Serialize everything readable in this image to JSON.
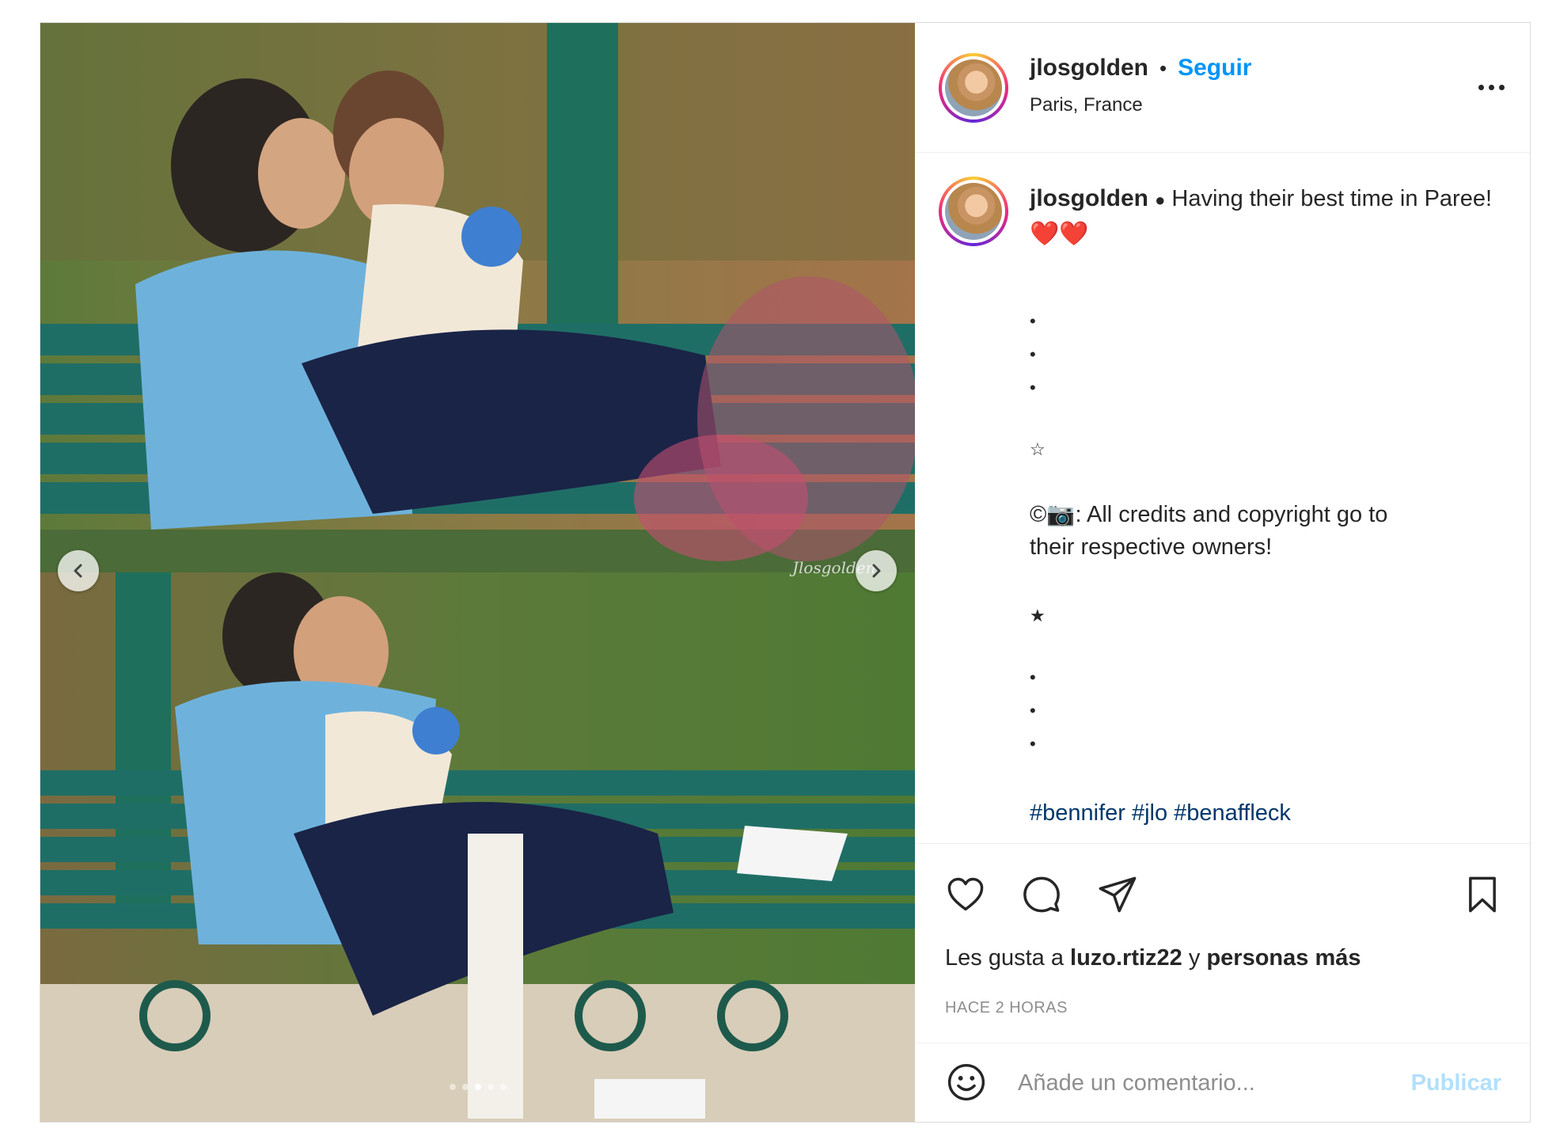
{
  "post": {
    "author": "jlosgolden",
    "separator": "•",
    "follow_label": "Seguir",
    "location": "Paris, France",
    "watermark": "Jlosgolden",
    "carousel": {
      "slides": 5,
      "active_index": 2
    }
  },
  "caption": {
    "username": "jlosgolden",
    "bullet": "●",
    "text": "Having their best time in Paree!",
    "emoji": "❤️❤️",
    "dot": "•",
    "star_outline": "☆",
    "credits_line1": "©📷: All credits and copyright go to",
    "credits_line2": "their respective owners!",
    "star_filled": "★",
    "hashtags": [
      "#bennifer",
      "#jlo",
      "#benaffleck"
    ]
  },
  "actions": {
    "likes_prefix": "Les gusta a",
    "likes_user": "luzo.rtiz22",
    "likes_mid": "y",
    "likes_suffix": "personas más",
    "timestamp": "HACE 2 HORAS"
  },
  "comment": {
    "placeholder": "Añade un comentario...",
    "publish_label": "Publicar"
  },
  "icons": {
    "like": "heart-icon",
    "comment": "comment-icon",
    "share": "share-icon",
    "save": "bookmark-icon",
    "emoji": "emoji-icon",
    "more": "more-options-icon"
  },
  "colors": {
    "accent": "#0095f6",
    "publish_disabled": "#b2dffc",
    "hashtag": "#00376b",
    "muted": "#8e8e8e"
  }
}
